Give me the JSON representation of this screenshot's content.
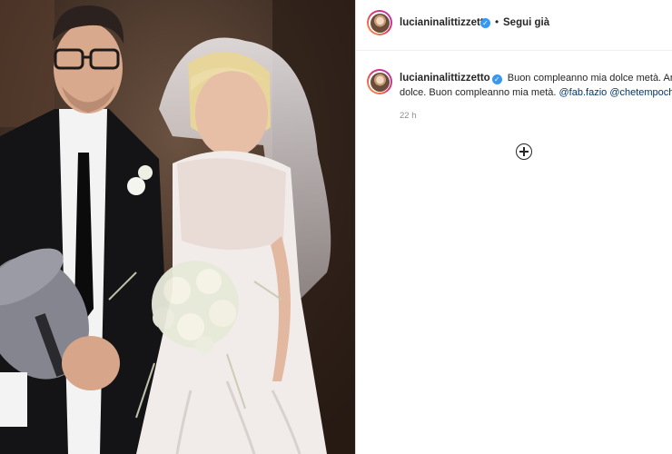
{
  "post": {
    "username": "lucianinalittizzetto",
    "verified_icon": "verified-badge-icon",
    "follow_label": "Segui già",
    "separator": "•",
    "caption": {
      "username": "lucianinalittizzetto",
      "text_line1": "Buon compleanno mia dolce metà. Anzi. To",
      "text_line2": "dolce. Buon compleanno mia metà.",
      "mention1": "@fab.fazio",
      "mention2": "@chetempochefa"
    },
    "time": "22 h",
    "load_more_icon": "plus-circle-icon"
  },
  "colors": {
    "accent": "#3897f0",
    "text": "#262626",
    "muted": "#8e8e8e",
    "link": "#00376b"
  }
}
